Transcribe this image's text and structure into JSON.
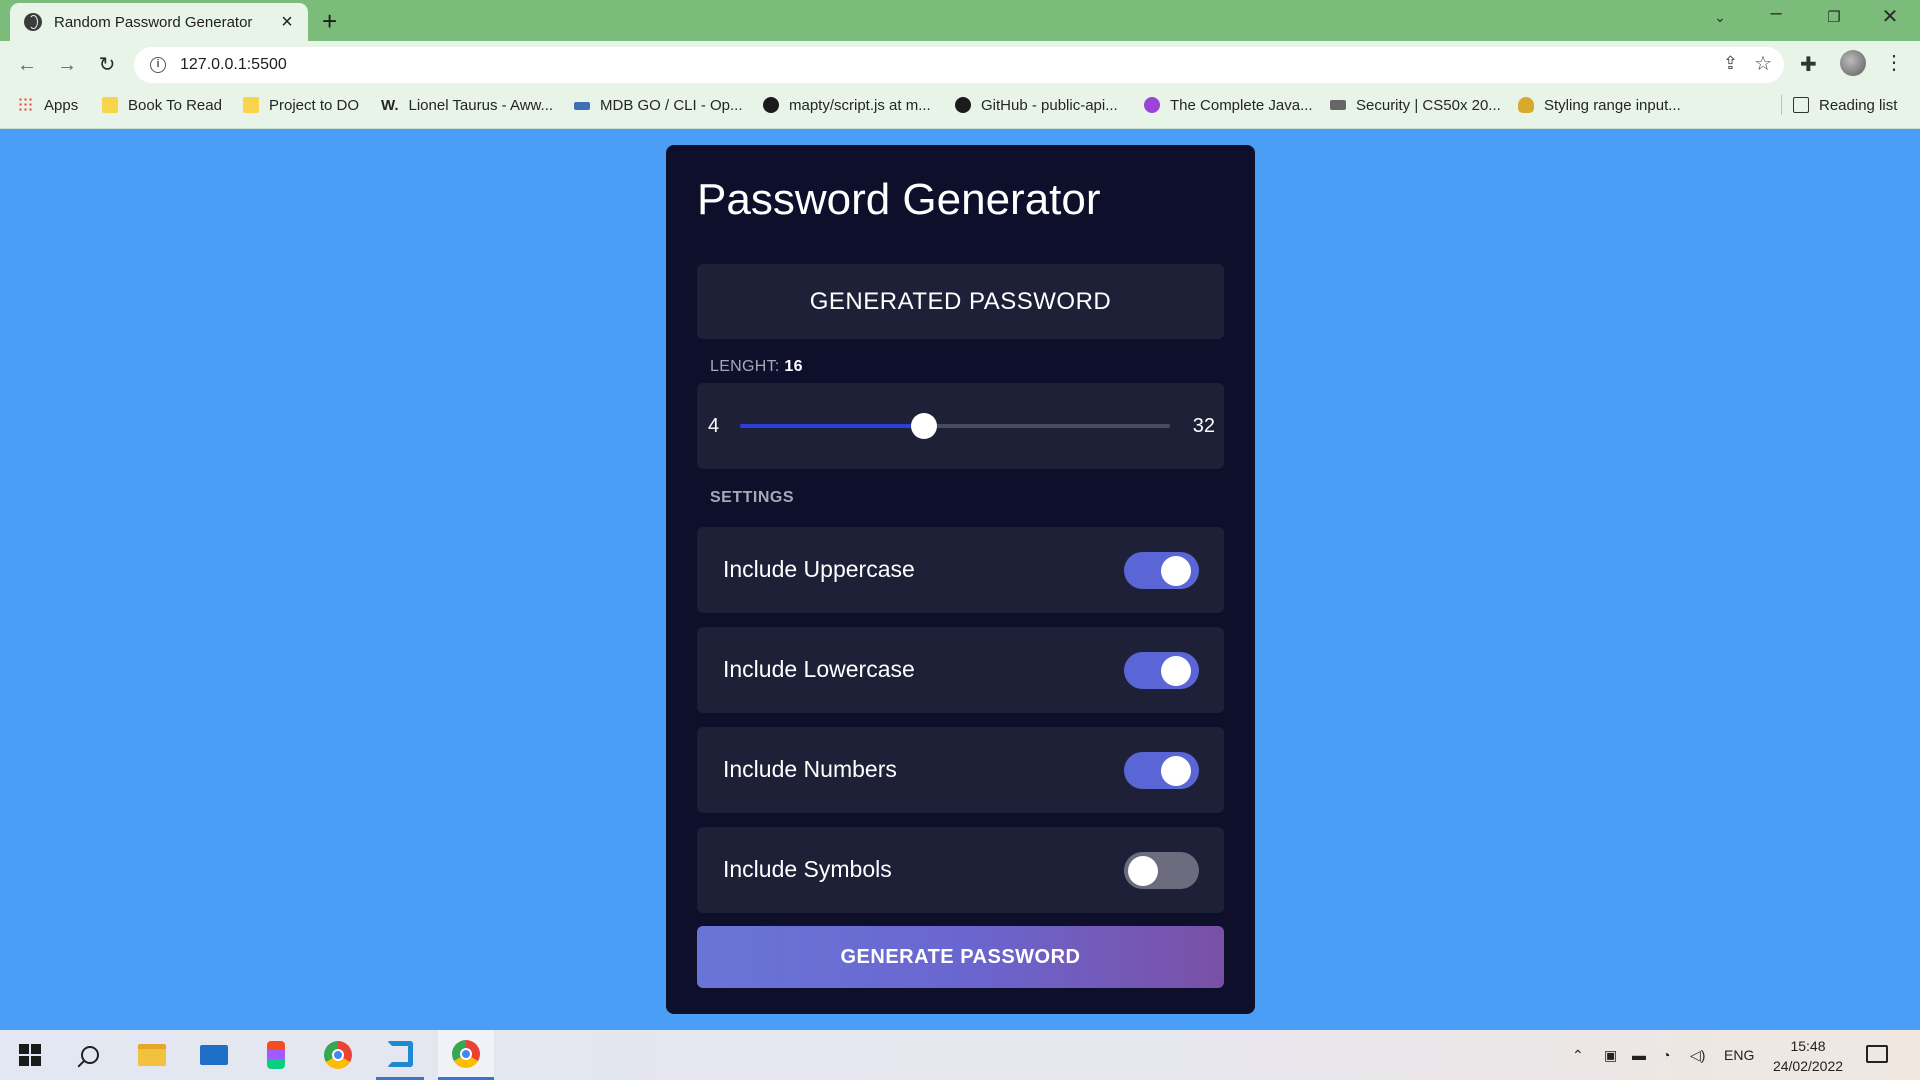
{
  "browser": {
    "tab_title": "Random Password Generator",
    "url": "127.0.0.1:5500",
    "bookmarks": [
      {
        "label": "Apps",
        "icon": "apps-grid-icon"
      },
      {
        "label": "Book To Read",
        "icon": "folder-icon"
      },
      {
        "label": "Project to DO",
        "icon": "folder-icon"
      },
      {
        "label": "Lionel Taurus - Aww...",
        "icon": "w-logo-icon"
      },
      {
        "label": "MDB GO / CLI - Op...",
        "icon": "mdb-logo-icon"
      },
      {
        "label": "mapty/script.js at m...",
        "icon": "github-icon"
      },
      {
        "label": "GitHub - public-api...",
        "icon": "github-icon"
      },
      {
        "label": "The Complete Java...",
        "icon": "udemy-icon"
      },
      {
        "label": "Security | CS50x 20...",
        "icon": "cs50-icon"
      },
      {
        "label": "Styling range input...",
        "icon": "favicon-icon"
      }
    ],
    "reading_list": "Reading list",
    "w_glyph": "W."
  },
  "app": {
    "title": "Password Generator",
    "password_placeholder": "GENERATED PASSWORD",
    "length_label": "LENGHT:",
    "length_value": "16",
    "slider": {
      "min": "4",
      "max": "32",
      "value": 16
    },
    "settings_label": "SETTINGS",
    "settings": [
      {
        "label": "Include Uppercase",
        "checked": true
      },
      {
        "label": "Include Lowercase",
        "checked": true
      },
      {
        "label": "Include Numbers",
        "checked": true
      },
      {
        "label": "Include Symbols",
        "checked": false
      }
    ],
    "generate_label": "GENERATE PASSWORD",
    "accent_color": "#5b66d6",
    "background_color": "#4a9ef5",
    "card_color": "#0d0f2b"
  },
  "taskbar": {
    "language": "ENG",
    "time": "15:48",
    "date": "24/02/2022"
  }
}
